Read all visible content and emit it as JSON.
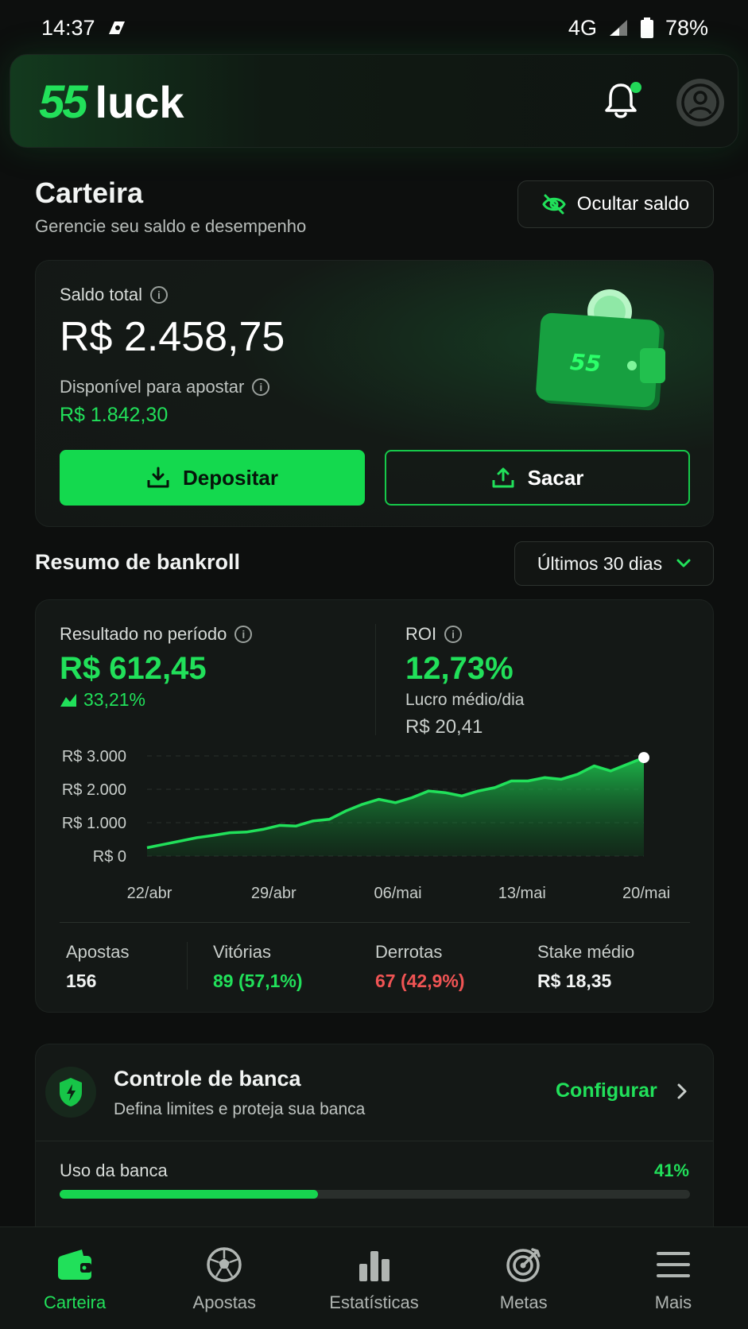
{
  "status_bar": {
    "time": "14:37",
    "network": "4G",
    "battery": "78%"
  },
  "header": {
    "logo_number": "55",
    "logo_word": "luck"
  },
  "page": {
    "title": "Carteira",
    "subtitle": "Gerencie seu saldo e desempenho",
    "hide_label": "Ocultar saldo"
  },
  "balance": {
    "total_label": "Saldo total",
    "total_value": "R$ 2.458,75",
    "available_label": "Disponível para apostar",
    "available_value": "R$ 1.842,30",
    "deposit_label": "Depositar",
    "withdraw_label": "Sacar",
    "wallet_brand": "55"
  },
  "bankroll": {
    "section_title": "Resumo de bankroll",
    "period": "Últimos 30 dias",
    "result_label": "Resultado no período",
    "result_value": "R$ 612,45",
    "result_change": "33,21%",
    "roi_label": "ROI",
    "roi_value": "12,73%",
    "avg_profit_label": "Lucro médio/dia",
    "avg_profit_value": "R$ 20,41",
    "stats": {
      "bets_label": "Apostas",
      "bets_value": "156",
      "wins_label": "Vitórias",
      "wins_value": "89 (57,1%)",
      "losses_label": "Derrotas",
      "losses_value": "67 (42,9%)",
      "stake_label": "Stake médio",
      "stake_value": "R$ 18,35"
    }
  },
  "chart_data": {
    "type": "area",
    "y_ticks": [
      "R$ 3.000",
      "R$ 2.000",
      "R$ 1.000",
      "R$ 0"
    ],
    "x_ticks": [
      "22/abr",
      "29/abr",
      "06/mai",
      "13/mai",
      "20/mai"
    ],
    "ylim": [
      0,
      3000
    ],
    "grid": true,
    "series": [
      {
        "values": [
          250,
          350,
          450,
          550,
          620,
          700,
          720,
          800,
          920,
          900,
          1050,
          1100,
          1350,
          1550,
          1700,
          1600,
          1750,
          1950,
          1900,
          1800,
          1950,
          2050,
          2250,
          2250,
          2350,
          2300,
          2450,
          2700,
          2550,
          2750,
          2950
        ]
      }
    ]
  },
  "control": {
    "title": "Controle de banca",
    "subtitle": "Defina limites e proteja sua banca",
    "configure_label": "Configurar",
    "usage_label": "Uso da banca",
    "usage_value": "41%",
    "usage_fraction": 0.41
  },
  "nav": {
    "items": [
      {
        "label": "Carteira",
        "icon": "wallet-icon"
      },
      {
        "label": "Apostas",
        "icon": "soccer-ball-icon"
      },
      {
        "label": "Estatísticas",
        "icon": "bar-chart-icon"
      },
      {
        "label": "Metas",
        "icon": "target-icon"
      },
      {
        "label": "Mais",
        "icon": "menu-icon"
      }
    ]
  },
  "colors": {
    "accent": "#21e05a",
    "negative": "#f05454",
    "background": "#0d0f0e"
  }
}
